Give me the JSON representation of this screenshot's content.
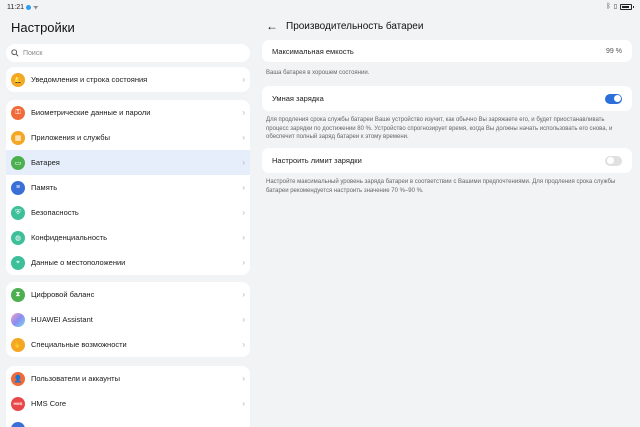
{
  "status_bar": {
    "time": "11:21"
  },
  "left_panel": {
    "title": "Настройки",
    "search_placeholder": "Поиск",
    "groups": [
      {
        "items": [
          {
            "label": "Уведомления и строка состояния",
            "icon": "bell-icon",
            "color": "#f5a623",
            "glyph": "🔔"
          }
        ]
      },
      {
        "items": [
          {
            "label": "Биометрические данные и пароли",
            "icon": "key-icon",
            "color": "#f06a3a",
            "glyph": "⚿"
          },
          {
            "label": "Приложения и службы",
            "icon": "apps-icon",
            "color": "#f5a623",
            "glyph": "▦"
          },
          {
            "label": "Батарея",
            "icon": "battery-icon",
            "color": "#4cb050",
            "glyph": "▭",
            "selected": true
          },
          {
            "label": "Память",
            "icon": "storage-icon",
            "color": "#3a6fd8",
            "glyph": "≡"
          },
          {
            "label": "Безопасность",
            "icon": "shield-icon",
            "color": "#3dbf9a",
            "glyph": "⛨"
          },
          {
            "label": "Конфиденциальность",
            "icon": "privacy-icon",
            "color": "#3dbf9a",
            "glyph": "◍"
          },
          {
            "label": "Данные о местоположении",
            "icon": "location-icon",
            "color": "#3dbf9a",
            "glyph": "⌖"
          }
        ]
      },
      {
        "items": [
          {
            "label": "Цифровой баланс",
            "icon": "hourglass-icon",
            "color": "#4cb050",
            "glyph": "⧗"
          },
          {
            "label": "HUAWEI Assistant",
            "icon": "assistant-icon",
            "color": "#b06ad8",
            "glyph": "◉"
          },
          {
            "label": "Специальные возможности",
            "icon": "accessibility-icon",
            "color": "#f5a623",
            "glyph": "✋"
          }
        ]
      },
      {
        "items": [
          {
            "label": "Пользователи и аккаунты",
            "icon": "user-icon",
            "color": "#f06a3a",
            "glyph": "👤"
          },
          {
            "label": "HMS Core",
            "icon": "hms-icon",
            "color": "#e84848",
            "glyph": "HMS"
          },
          {
            "label": "",
            "icon": "partial-icon",
            "color": "#3a6fd8",
            "glyph": ""
          }
        ]
      }
    ]
  },
  "right_panel": {
    "title": "Производительность батареи",
    "max_capacity": {
      "label": "Максимальная емкость",
      "value": "99 %"
    },
    "capacity_desc": "Ваша батарея в хорошем состоянии.",
    "smart_charge": {
      "label": "Умная зарядка",
      "enabled": true
    },
    "smart_charge_desc": "Для продления срока службы батареи Ваше устройство изучит, как обычно Вы заряжаете его, и будет приостанавливать процесс зарядки по достижении 80 %. Устройство спрогнозирует время, когда Вы должны начать использовать его снова, и обеспечит полный заряд батареи к этому времени.",
    "charge_limit": {
      "label": "Настроить лимит зарядки",
      "enabled": false
    },
    "charge_limit_desc": "Настройте максимальный уровень заряда батареи в соответствии с Вашими предпочтениями. Для продления срока службы батареи рекомендуется настроить значение 70 %–90 %."
  }
}
